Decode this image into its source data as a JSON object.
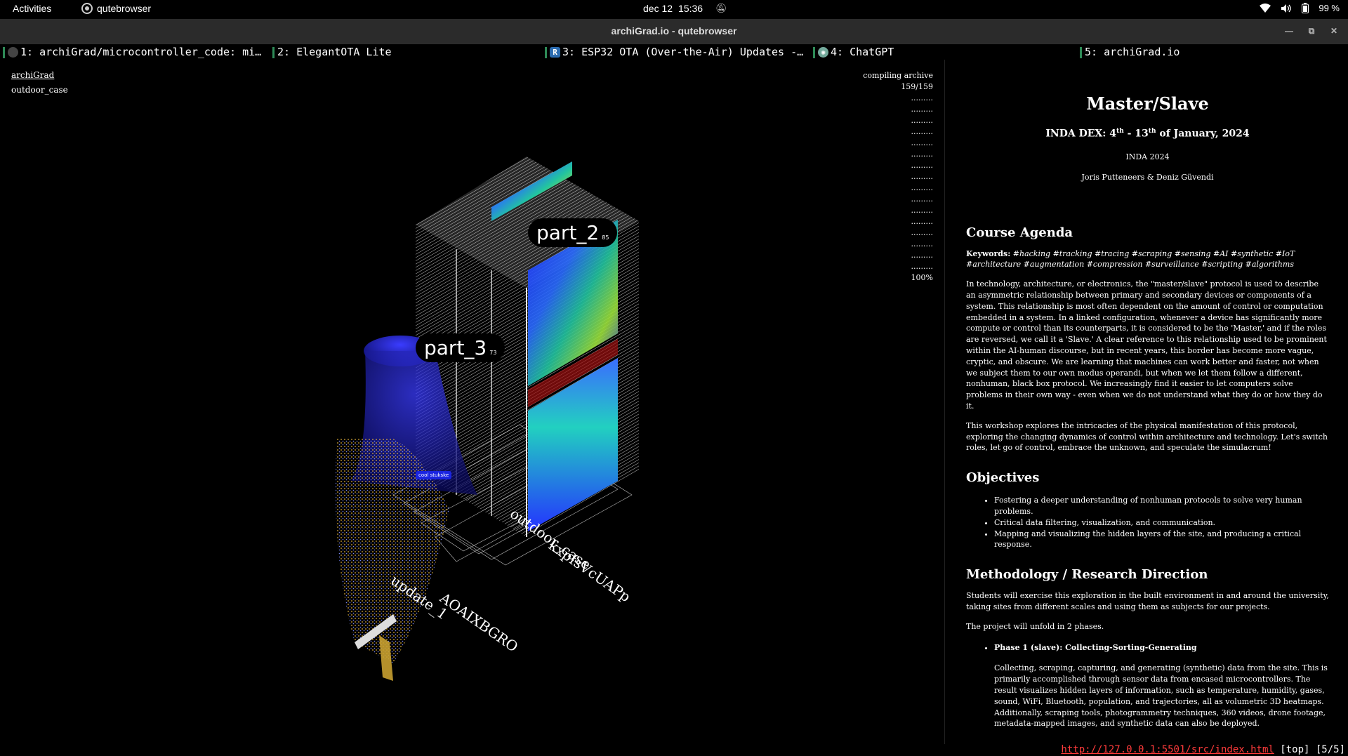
{
  "topbar": {
    "activities": "Activities",
    "app_name": "qutebrowser",
    "date": "dec 12",
    "time": "15:36",
    "battery": "99 %"
  },
  "window": {
    "title": "archiGrad.io - qutebrowser"
  },
  "tabs": [
    {
      "label": "1: archiGrad/microcontroller_code: mi…",
      "icon": "github-icon"
    },
    {
      "label": "2: ElegantOTA Lite",
      "icon": ""
    },
    {
      "label": "3: ESP32 OTA (Over-the-Air) Updates -…",
      "icon": "r-icon"
    },
    {
      "label": "4: ChatGPT",
      "icon": "chatgpt-icon"
    },
    {
      "label": "5: archiGrad.io",
      "icon": ""
    }
  ],
  "viewport": {
    "crumb_top": "archiGrad",
    "crumb_sub": "outdoor_case",
    "progress_label": "compiling archive",
    "progress_count": "159/159",
    "progress_pct": "100%",
    "labels": [
      {
        "name": "part_2",
        "count": "85"
      },
      {
        "name": "part_3",
        "count": "73"
      }
    ],
    "chip": "cool stukske",
    "floor_texts": [
      "update_1",
      "AOAIXBGRO",
      "outdoor_case",
      "kxpfsVcUAPp"
    ]
  },
  "article": {
    "title": "Master/Slave",
    "subtitle_prefix": "INDA DEX: 4",
    "subtitle_sup1": "th",
    "subtitle_mid": " - 13",
    "subtitle_sup2": "th",
    "subtitle_suffix": " of January, 2024",
    "line1": "INDA 2024",
    "line2": "Joris Putteneers & Deniz Güvendi",
    "agenda_heading": "Course Agenda",
    "keywords_label": "Keywords:",
    "keywords": " #hacking #tracking #tracing #scraping #sensing #AI #synthetic #IoT #architecture #augmentation #compression #surveillance #scripting #algorithms",
    "para1": "In technology, architecture, or electronics, the \"master/slave\" protocol is used to describe an asymmetric relationship between primary and secondary devices or components of a system. This relationship is most often dependent on the amount of control or computation embedded in a system. In a linked configuration, whenever a device has significantly more compute or control than its counterparts, it is considered to be the 'Master,' and if the roles are reversed, we call it a 'Slave.' A clear reference to this relationship used to be prominent within the AI-human discourse, but in recent years, this border has become more vague, cryptic, and obscure. We are learning that machines can work better and faster, not when we subject them to our own modus operandi, but when we let them follow a different, nonhuman, black box protocol. We increasingly find it easier to let computers solve problems in their own way - even when we do not understand what they do or how they do it.",
    "para2": "This workshop explores the intricacies of the physical manifestation of this protocol, exploring the changing dynamics of control within architecture and technology. Let's switch roles, let go of control, embrace the unknown, and speculate the simulacrum!",
    "objectives_heading": "Objectives",
    "objectives": [
      "Fostering a deeper understanding of nonhuman protocols to solve very human problems.",
      "Critical data filtering, visualization, and communication.",
      "Mapping and visualizing the hidden layers of the site, and producing a critical response."
    ],
    "method_heading": "Methodology / Research Direction",
    "method_p1": "Students will exercise this exploration in the built environment in and around the university, taking sites from different scales and using them as subjects for our projects.",
    "method_p2": "The project will unfold in 2 phases.",
    "phase1_title": "Phase 1 (slave): Collecting-Sorting-Generating",
    "phase1_body": "Collecting, scraping, capturing, and generating (synthetic) data from the site. This is primarily accomplished through sensor data from encased microcontrollers. The result visualizes hidden layers of information, such as temperature, humidity, gases, sound, WiFi, Bluetooth, population, and trajectories, all as volumetric 3D heatmaps. Additionally, scraping tools, photogrammetry techniques, 360 videos, drone footage, metadata-mapped images, and synthetic data can also be deployed."
  },
  "status": {
    "url": "http://127.0.0.1:5501/src/index.html",
    "position": "[top] [5/5]"
  },
  "colors": {
    "tab_indicator": "#2e8b57",
    "status_url": "#ff3b3b",
    "chip": "#1a24e0"
  }
}
